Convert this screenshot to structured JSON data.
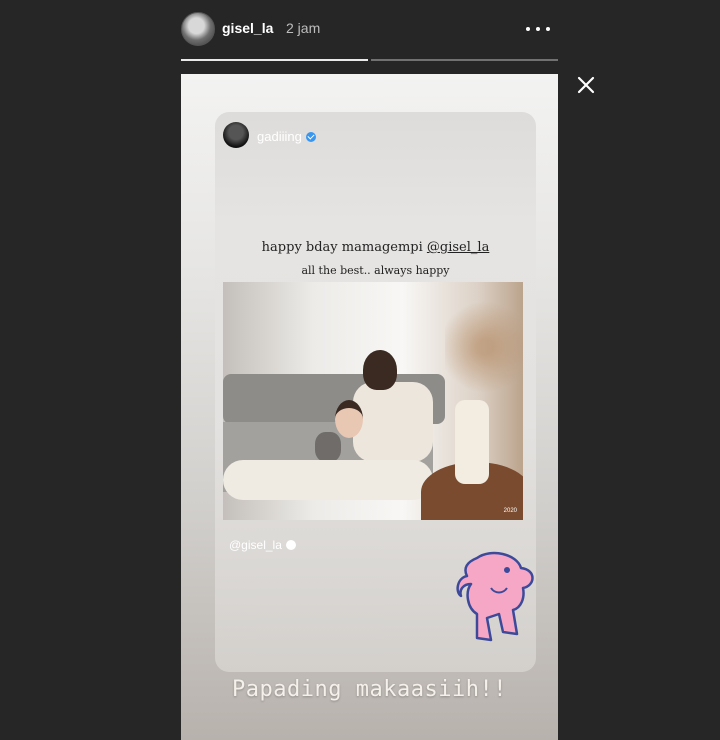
{
  "header": {
    "username": "gisel_la",
    "time": "2 jam"
  },
  "icons": {
    "avatar": "profile-avatar",
    "more": "more-options-icon",
    "close": "close-icon",
    "verified": "verified-badge-icon"
  },
  "progress": {
    "segments": 2,
    "viewed": 1
  },
  "post": {
    "username": "gadiiing",
    "caption_text": "happy bday mamagempi ",
    "caption_mention": "@gisel_la",
    "caption_line2": "all the best.. always happy",
    "photo_watermark": "2020",
    "photo_tag": "@gisel_la"
  },
  "story_caption": "Papading makaasiih!!",
  "colors": {
    "background": "#262626",
    "verified": "#3897f0",
    "sticker": "#f6a7c5"
  }
}
